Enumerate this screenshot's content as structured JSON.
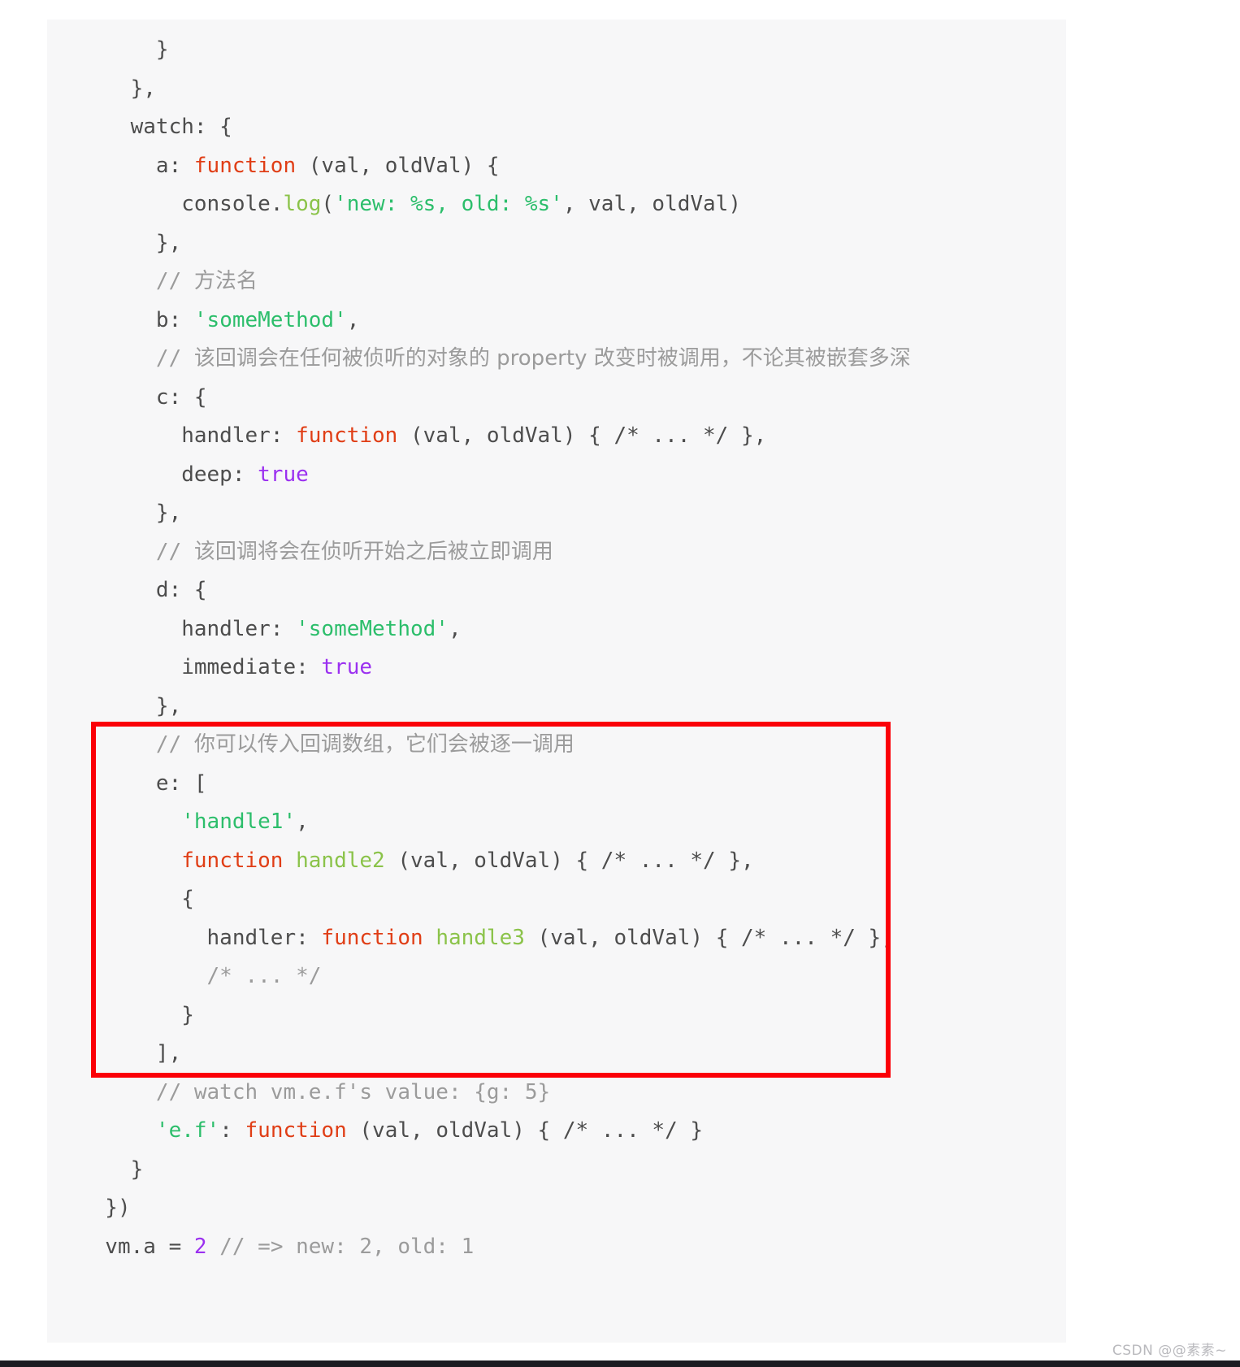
{
  "document": {
    "kind": "code-snippet",
    "language": "javascript",
    "background": "#f7f7f8",
    "page_background": "#ffffff"
  },
  "annotation": {
    "type": "rectangle-highlight",
    "color": "#fb0007",
    "covers": "e: [ ... ], array-of-callbacks block"
  },
  "watermark": {
    "text": "CSDN @@素素~"
  },
  "colors": {
    "keyword": "#e03e16",
    "function_name": "#8bc34a",
    "string": "#2cbe6b",
    "boolean": "#9b30f0",
    "number": "#9b30f0",
    "comment": "#9b9b9b",
    "plain": "#4d4d4d",
    "annotation_red": "#fb0007"
  },
  "code": {
    "lines": [
      {
        "id": "l01",
        "segments": [
          {
            "text": "      }",
            "cls": "t-plain"
          }
        ]
      },
      {
        "id": "l02",
        "segments": [
          {
            "text": "    },",
            "cls": "t-plain"
          }
        ]
      },
      {
        "id": "l03",
        "segments": [
          {
            "text": "    watch: {",
            "cls": "t-plain"
          }
        ]
      },
      {
        "id": "l04",
        "segments": [
          {
            "text": "      a: ",
            "cls": "t-plain"
          },
          {
            "text": "function",
            "cls": "t-kw"
          },
          {
            "text": " (val, oldVal) {",
            "cls": "t-plain"
          }
        ]
      },
      {
        "id": "l05",
        "segments": [
          {
            "text": "        console.",
            "cls": "t-plain"
          },
          {
            "text": "log",
            "cls": "t-fn"
          },
          {
            "text": "(",
            "cls": "t-plain"
          },
          {
            "text": "'new: %s, old: %s'",
            "cls": "t-str"
          },
          {
            "text": ", val, oldVal)",
            "cls": "t-plain"
          }
        ]
      },
      {
        "id": "l06",
        "segments": [
          {
            "text": "      },",
            "cls": "t-plain"
          }
        ]
      },
      {
        "id": "l07",
        "segments": [
          {
            "text": "      // ",
            "cls": "t-comment"
          },
          {
            "text": "方法名",
            "cls": "t-cjk"
          }
        ]
      },
      {
        "id": "l08",
        "segments": [
          {
            "text": "      b: ",
            "cls": "t-plain"
          },
          {
            "text": "'someMethod'",
            "cls": "t-str"
          },
          {
            "text": ",",
            "cls": "t-plain"
          }
        ]
      },
      {
        "id": "l09",
        "segments": [
          {
            "text": "      // ",
            "cls": "t-comment"
          },
          {
            "text": "该回调会在任何被侦听的对象的 property 改变时被调用，不论其被嵌套多深",
            "cls": "t-cjk"
          }
        ]
      },
      {
        "id": "l10",
        "segments": [
          {
            "text": "      c: {",
            "cls": "t-plain"
          }
        ]
      },
      {
        "id": "l11",
        "segments": [
          {
            "text": "        handler: ",
            "cls": "t-plain"
          },
          {
            "text": "function",
            "cls": "t-kw"
          },
          {
            "text": " (val, oldVal) { /* ... */ },",
            "cls": "t-plain"
          }
        ]
      },
      {
        "id": "l12",
        "segments": [
          {
            "text": "        deep: ",
            "cls": "t-plain"
          },
          {
            "text": "true",
            "cls": "t-bool"
          }
        ]
      },
      {
        "id": "l13",
        "segments": [
          {
            "text": "      },",
            "cls": "t-plain"
          }
        ]
      },
      {
        "id": "l14",
        "segments": [
          {
            "text": "      // ",
            "cls": "t-comment"
          },
          {
            "text": "该回调将会在侦听开始之后被立即调用",
            "cls": "t-cjk"
          }
        ]
      },
      {
        "id": "l15",
        "segments": [
          {
            "text": "      d: {",
            "cls": "t-plain"
          }
        ]
      },
      {
        "id": "l16",
        "segments": [
          {
            "text": "        handler: ",
            "cls": "t-plain"
          },
          {
            "text": "'someMethod'",
            "cls": "t-str"
          },
          {
            "text": ",",
            "cls": "t-plain"
          }
        ]
      },
      {
        "id": "l17",
        "segments": [
          {
            "text": "        immediate: ",
            "cls": "t-plain"
          },
          {
            "text": "true",
            "cls": "t-bool"
          }
        ]
      },
      {
        "id": "l18",
        "segments": [
          {
            "text": "      },",
            "cls": "t-plain"
          }
        ]
      },
      {
        "id": "l19",
        "segments": [
          {
            "text": "      // ",
            "cls": "t-comment"
          },
          {
            "text": "你可以传入回调数组，它们会被逐一调用",
            "cls": "t-cjk"
          }
        ]
      },
      {
        "id": "l20",
        "segments": [
          {
            "text": "      e: [",
            "cls": "t-plain"
          }
        ]
      },
      {
        "id": "l21",
        "segments": [
          {
            "text": "        ",
            "cls": "t-plain"
          },
          {
            "text": "'handle1'",
            "cls": "t-str"
          },
          {
            "text": ",",
            "cls": "t-plain"
          }
        ]
      },
      {
        "id": "l22",
        "segments": [
          {
            "text": "        ",
            "cls": "t-plain"
          },
          {
            "text": "function",
            "cls": "t-kw"
          },
          {
            "text": " ",
            "cls": "t-plain"
          },
          {
            "text": "handle2",
            "cls": "t-fn"
          },
          {
            "text": " (val, oldVal) { /* ... */ },",
            "cls": "t-plain"
          }
        ]
      },
      {
        "id": "l23",
        "segments": [
          {
            "text": "        {",
            "cls": "t-plain"
          }
        ]
      },
      {
        "id": "l24",
        "segments": [
          {
            "text": "          handler: ",
            "cls": "t-plain"
          },
          {
            "text": "function",
            "cls": "t-kw"
          },
          {
            "text": " ",
            "cls": "t-plain"
          },
          {
            "text": "handle3",
            "cls": "t-fn"
          },
          {
            "text": " (val, oldVal) { /* ... */ },",
            "cls": "t-plain"
          }
        ]
      },
      {
        "id": "l25",
        "segments": [
          {
            "text": "          /* ... */",
            "cls": "t-comment"
          }
        ]
      },
      {
        "id": "l26",
        "segments": [
          {
            "text": "        }",
            "cls": "t-plain"
          }
        ]
      },
      {
        "id": "l27",
        "segments": [
          {
            "text": "      ],",
            "cls": "t-plain"
          }
        ]
      },
      {
        "id": "l28",
        "segments": [
          {
            "text": "      // watch vm.e.f's value: {g: 5}",
            "cls": "t-comment"
          }
        ]
      },
      {
        "id": "l29",
        "segments": [
          {
            "text": "      ",
            "cls": "t-plain"
          },
          {
            "text": "'e.f'",
            "cls": "t-str"
          },
          {
            "text": ": ",
            "cls": "t-plain"
          },
          {
            "text": "function",
            "cls": "t-kw"
          },
          {
            "text": " (val, oldVal) { /* ... */ }",
            "cls": "t-plain"
          }
        ]
      },
      {
        "id": "l30",
        "segments": [
          {
            "text": "    }",
            "cls": "t-plain"
          }
        ]
      },
      {
        "id": "l31",
        "segments": [
          {
            "text": "  })",
            "cls": "t-plain"
          }
        ]
      },
      {
        "id": "l32",
        "segments": [
          {
            "text": "  vm.a = ",
            "cls": "t-plain"
          },
          {
            "text": "2",
            "cls": "t-num"
          },
          {
            "text": " ",
            "cls": "t-plain"
          },
          {
            "text": "// => new: 2, old: 1",
            "cls": "t-comment"
          }
        ]
      }
    ]
  }
}
